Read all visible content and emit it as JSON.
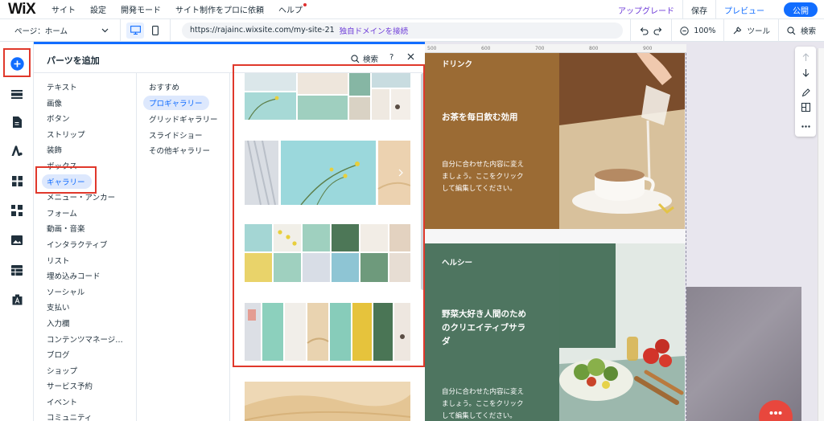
{
  "topbar": {
    "logo": "WiX",
    "menu": [
      "サイト",
      "設定",
      "開発モード",
      "サイト制作をプロに依頼",
      "ヘルプ"
    ],
    "upgrade": "アップグレード",
    "save": "保存",
    "preview": "プレビュー",
    "publish": "公開"
  },
  "toolbar": {
    "page_label": "ページ：ホーム",
    "url": "https://rajainc.wixsite.com/my-site-21",
    "domain_link": "独自ドメインを接続",
    "zoom": "100%",
    "tools": "ツール",
    "search": "検索"
  },
  "panel": {
    "title": "パーツを追加",
    "search": "検索",
    "help": "?",
    "categories": [
      "テキスト",
      "画像",
      "ボタン",
      "ストリップ",
      "装飾",
      "ボックス",
      "ギャラリー",
      "メニュー・アンカー",
      "フォーム",
      "動画・音楽",
      "インタラクティブ",
      "リスト",
      "埋め込みコード",
      "ソーシャル",
      "支払い",
      "入力欄",
      "コンテンツマネージ…",
      "ブログ",
      "ショップ",
      "サービス予約",
      "イベント",
      "コミュニティ"
    ],
    "selected_category": "ギャラリー",
    "subcategories": [
      "おすすめ",
      "プロギャラリー",
      "グリッドギャラリー",
      "スライドショー",
      "その他ギャラリー"
    ],
    "selected_subcategory": "プロギャラリー"
  },
  "canvas": {
    "ruler": [
      "500",
      "600",
      "700",
      "800",
      "900"
    ],
    "drink": {
      "label": "ドリンク",
      "title": "お茶を毎日飲む効用",
      "body": [
        "自分に合わせた内容に変え",
        "ましょう。ここをクリック",
        "して編集してください。"
      ]
    },
    "healthy": {
      "label": "ヘルシー",
      "title": [
        "野菜大好き人間のため",
        "のクリエイティブサラ",
        "ダ"
      ],
      "body": [
        "自分に合わせた内容に変え",
        "ましょう。ここをクリック",
        "して編集してください。"
      ]
    }
  },
  "colors": {
    "accent": "#116dff",
    "upgrade": "#6d3bd8",
    "highlight_box": "#e0382b",
    "drink_bg": "#9b6b34",
    "healthy_bg": "#4e7560"
  },
  "icons": [
    "add-icon",
    "strip-icon",
    "page-icon",
    "theme-icon",
    "apps-icon",
    "puzzle-icon",
    "media-icon",
    "table-icon",
    "font-icon",
    "desktop-icon",
    "mobile-icon",
    "undo-icon",
    "redo-icon",
    "zoom-out-icon",
    "tools-icon",
    "search-icon",
    "close-icon",
    "arrow-up-icon",
    "arrow-down-icon",
    "pen-icon",
    "layout-icon",
    "more-icon",
    "chat-icon"
  ]
}
